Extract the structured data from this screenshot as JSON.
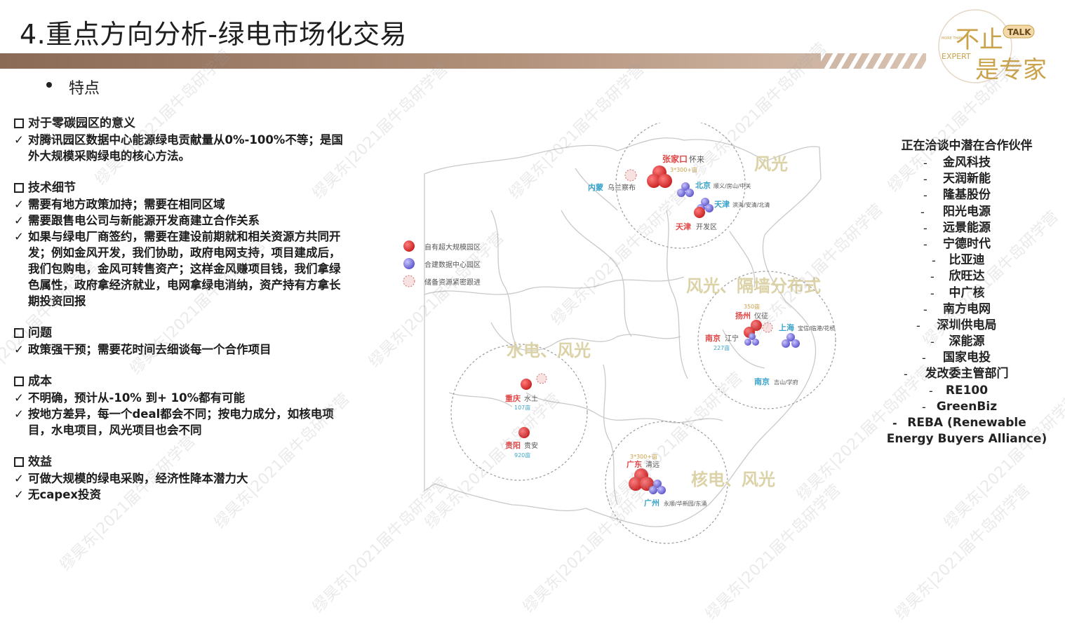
{
  "title": "4.重点方向分析-绿电市场化交易",
  "bullet": "特点",
  "logo": {
    "text_talk": "TALK",
    "text_expert": "EXPERT",
    "text_more": "MORE THAN",
    "text_main": "不止是专家"
  },
  "sections": [
    {
      "heading": "对于零碳园区的意义",
      "items": [
        "对腾讯园区数据中心能源绿电贡献量从0%-100%不等；是国外大规模采购绿电的核心方法。"
      ]
    },
    {
      "heading": "技术细节",
      "items": [
        "需要有地方政策加持；需要在相同区域",
        "需要跟售电公司与新能源开发商建立合作关系",
        "如果与绿电厂商签约，需要在建设前期就和相关资源方共同开发；例如金风开发，我们协助，政府电网支持，项目建成后，我们包购电，金风可转售资产；这样金风赚项目钱，我们拿绿色属性，政府拿经济就业，电网拿绿电消纳，资产持有方拿长期投资回报"
      ]
    },
    {
      "heading": "问题",
      "items": [
        "政策强干预；需要花时间去细谈每一个合作项目"
      ]
    },
    {
      "heading": "成本",
      "items": [
        "不明确，预计从-10% 到+ 10%都有可能",
        "按地方差异，每一个deal都会不同；按电力成分，如核电项目，水电项目，风光项目也会不同"
      ]
    },
    {
      "heading": "效益",
      "items": [
        "可做大规模的绿电采购，经济性降本潜力大",
        "无capex投资"
      ]
    }
  ],
  "map": {
    "legend": [
      "自有超大规模园区",
      "合建数据中心园区",
      "储备资源紧密跟进"
    ],
    "region_labels": [
      "风光",
      "风光、隔墙分布式",
      "水电、风光",
      "核电、风光"
    ],
    "sites": {
      "zjk_city": "张家口",
      "zjk_place": "怀来",
      "zjk_cap": "3*300+亩",
      "nm_city": "内蒙",
      "nm_place": "乌兰察布",
      "bj_city": "北京",
      "bj_place": "顺义/房山/中关",
      "tj1_city": "天津",
      "tj1_place": "滨海/安清/北清",
      "tj2_city": "天津",
      "tj2_place": "开发区",
      "yz_cap": "350亩",
      "yz_city": "扬州",
      "yz_place": "仪征",
      "sh_city": "上海",
      "sh_place": "宝信/临港/花桥",
      "nj1_city": "南京",
      "nj1_place": "江宁",
      "nj1_cap": "227亩",
      "nj2_city": "南京",
      "nj2_place": "吉山/学府",
      "cq_city": "重庆",
      "cq_place": "水土",
      "cq_cap": "107亩",
      "gy_city": "贵阳",
      "gy_place": "贵安",
      "gy_cap": "920亩",
      "gd_cap": "3*300+亩",
      "gd_city": "广东",
      "gd_place": "清远",
      "gz_city": "广州",
      "gz_place": "永顺/华新园/东涌"
    }
  },
  "partners": {
    "title": "正在洽谈中潜在合作伙伴",
    "items": [
      "金风科技",
      "天润新能",
      "隆基股份",
      "阳光电源",
      "远景能源",
      "宁德时代",
      "比亚迪",
      "欣旺达",
      "中广核",
      "南方电网",
      "深圳供电局",
      "深能源",
      "国家电投",
      "发改委主管部门",
      "RE100",
      "GreenBiz"
    ],
    "last": "REBA (Renewable Energy Buyers Alliance)"
  },
  "watermark": "缪昊东|2021届牛岛研学营",
  "colors": {
    "red_dot": "#d42a2a",
    "blue_dot": "#6f68d8",
    "title_bar": "#a48672",
    "accent_gold": "#c9a24a"
  }
}
